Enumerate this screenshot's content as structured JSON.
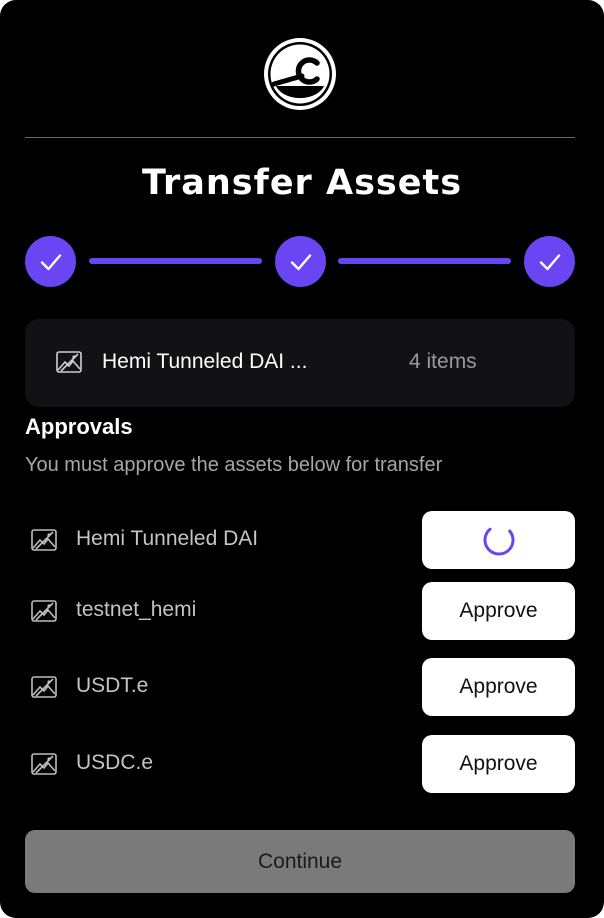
{
  "dialog": {
    "title": "Transfer Assets",
    "logo_icon": "brand-logo-icon",
    "steps": [
      {
        "status": "complete",
        "icon": "check-icon"
      },
      {
        "status": "complete",
        "icon": "check-icon"
      },
      {
        "status": "complete",
        "icon": "check-icon"
      }
    ],
    "accent_color": "#6a45f4"
  },
  "summary": {
    "icon": "image-placeholder-icon",
    "asset_name": "Hemi Tunneled DAI ...",
    "count": "4 items"
  },
  "approvals": {
    "title": "Approvals",
    "description": "You must approve the assets below for transfer",
    "items": [
      {
        "name": "Hemi Tunneled DAI",
        "icon": "image-placeholder-icon",
        "button_state": "loading",
        "button_label": ""
      },
      {
        "name": "testnet_hemi",
        "icon": "image-placeholder-icon",
        "button_state": "idle",
        "button_label": "Approve"
      },
      {
        "name": "USDT.e",
        "icon": "image-placeholder-icon",
        "button_state": "idle",
        "button_label": "Approve"
      },
      {
        "name": "USDC.e",
        "icon": "image-placeholder-icon",
        "button_state": "idle",
        "button_label": "Approve"
      }
    ]
  },
  "footer": {
    "continue_label": "Continue",
    "continue_enabled": false
  }
}
